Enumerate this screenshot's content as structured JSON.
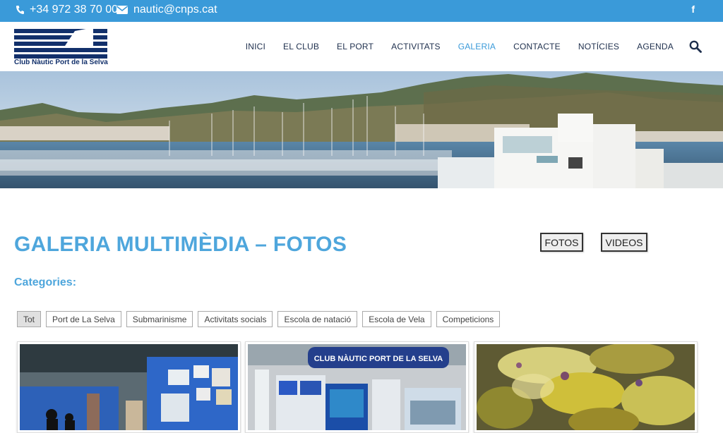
{
  "topbar": {
    "phone": "+34 972 38 70 00",
    "email": "nautic@cnps.cat",
    "phone_icon": "phone-icon",
    "email_icon": "envelope-icon",
    "social_icon": "facebook-icon"
  },
  "logo": {
    "text": "Club Nàutic Port de la Selva"
  },
  "nav": {
    "items": [
      "INICI",
      "EL CLUB",
      "EL PORT",
      "ACTIVITATS",
      "GALERIA",
      "CONTACTE",
      "NOTÍCIES",
      "AGENDA"
    ],
    "active": "GALERIA",
    "search_icon": "search-icon"
  },
  "page": {
    "title": "GALERIA MULTIMÈDIA – FOTOS",
    "fotos_button": "FOTOS",
    "videos_button": "VIDEOS",
    "categories_label": "Categories:"
  },
  "filters": [
    "Tot",
    "Port de La Selva",
    "Submarinisme",
    "Activitats socials",
    "Escola de natació",
    "Escola de Vela",
    "Competicions"
  ],
  "thumbnails": {
    "second_sign": "CLUB NÀUTIC PORT DE LA SELVA"
  },
  "colors": {
    "accent": "#3a9ad9",
    "title": "#4ea6dc",
    "nav_text": "#1e2f4d",
    "logo_navy": "#12306b"
  }
}
